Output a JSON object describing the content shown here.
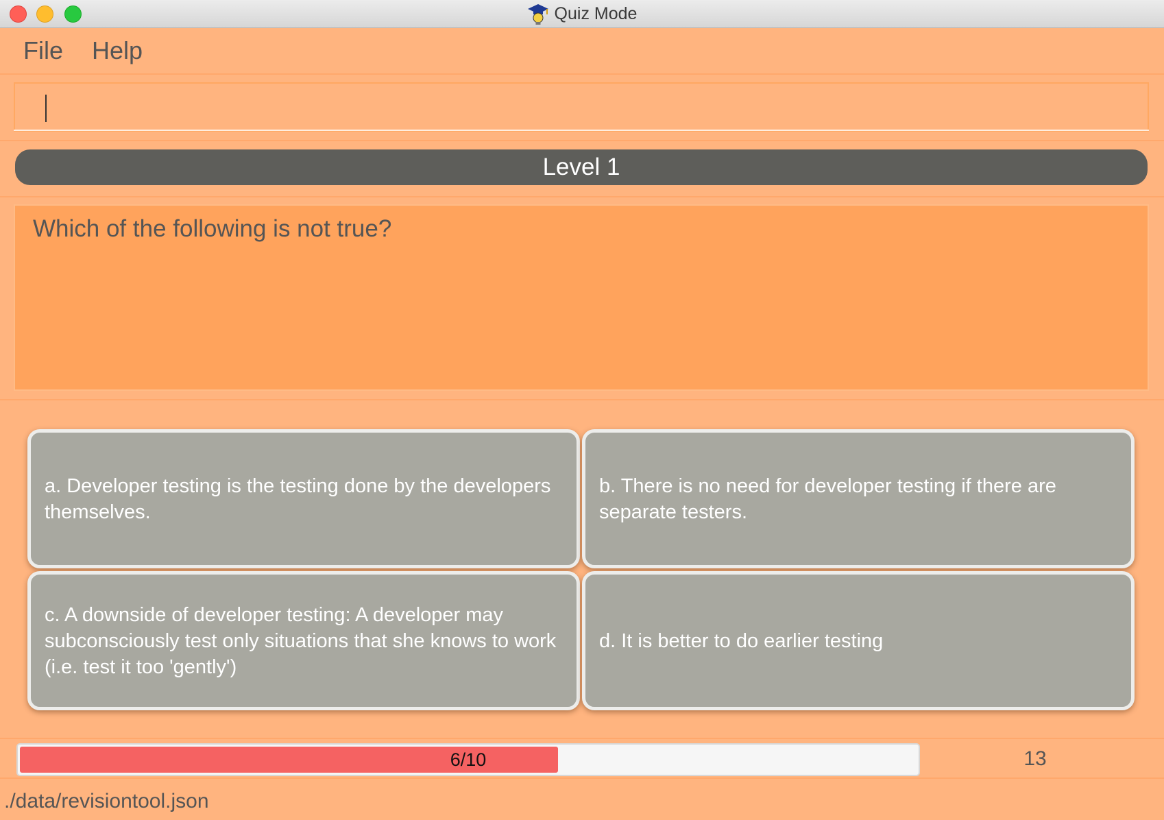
{
  "window": {
    "title": "Quiz Mode",
    "app_icon": "graduation-cap-lightbulb-icon"
  },
  "menu": {
    "file": "File",
    "help": "Help"
  },
  "command_box": {
    "value": "",
    "placeholder": ""
  },
  "level": {
    "label": "Level 1"
  },
  "question": {
    "text": "Which of the following is not true?"
  },
  "options": [
    {
      "text": "a. Developer testing is the testing done by the developers themselves."
    },
    {
      "text": "b. There is no need for developer testing if there are separate testers."
    },
    {
      "text": "c. A downside of developer testing: A developer may subconsciously test only situations that she knows to work (i.e. test it too 'gently')"
    },
    {
      "text": "d. It is better to do earlier testing"
    }
  ],
  "progress": {
    "current": 6,
    "total": 10,
    "label": "6/10",
    "fraction": 0.6,
    "fill_color": "#f56262"
  },
  "counter": {
    "value": "13"
  },
  "status": {
    "path": "./data/revisiontool.json"
  },
  "colors": {
    "background": "#ffb47f",
    "question_panel": "#ffa35c",
    "level_bar": "#5e5e5a",
    "option_button": "#a8a8a0"
  }
}
